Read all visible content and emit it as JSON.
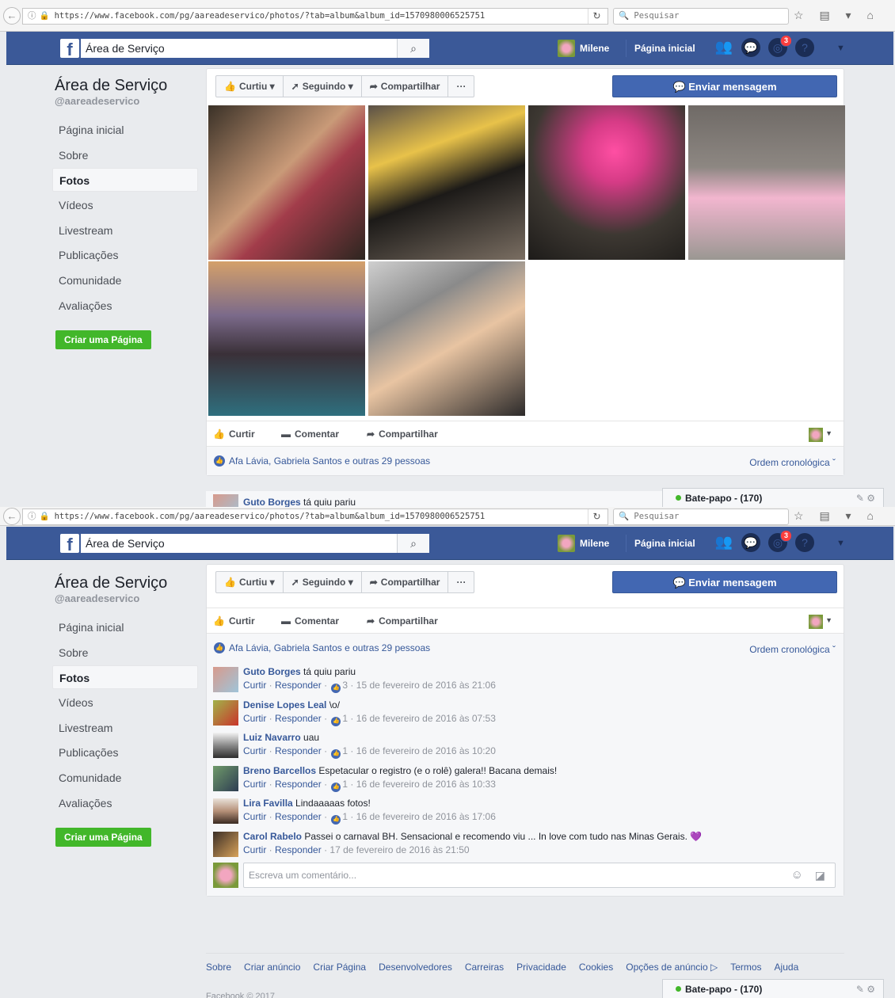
{
  "browser": {
    "url": "https://www.facebook.com/pg/aareadeservico/photos/?tab=album&album_id=1570980006525751",
    "search_placeholder": "Pesquisar"
  },
  "topbar": {
    "search_value": "Área de Serviço",
    "user_name": "Milene",
    "home_label": "Página inicial",
    "notifications_count": "3"
  },
  "page": {
    "name": "Área de Serviço",
    "handle": "@aareadeservico"
  },
  "nav": {
    "items": [
      "Página inicial",
      "Sobre",
      "Fotos",
      "Vídeos",
      "Livestream",
      "Publicações",
      "Comunidade",
      "Avaliações"
    ],
    "active": "Fotos",
    "create_page": "Criar uma Página"
  },
  "actions": {
    "like": "Curtiu",
    "follow": "Seguindo",
    "share": "Compartilhar",
    "more": "···",
    "send_message": "Enviar mensagem"
  },
  "feedback": {
    "like": "Curtir",
    "comment": "Comentar",
    "share": "Compartilhar",
    "likes_text": "Afa Lávia, Gabriela Santos e outras 29 pessoas",
    "order": "Ordem cronológica"
  },
  "comments": [
    {
      "author": "Guto Borges",
      "text": "tá quiu pariu",
      "reactions": "3",
      "time": "15 de fevereiro de 2016 às 21:06"
    },
    {
      "author": "Denise Lopes Leal",
      "text": "\\o/",
      "reactions": "1",
      "time": "16 de fevereiro de 2016 às 07:53"
    },
    {
      "author": "Luiz Navarro",
      "text": "uau",
      "reactions": "1",
      "time": "16 de fevereiro de 2016 às 10:20"
    },
    {
      "author": "Breno Barcellos",
      "text": "Espetacular o registro (e o rolê) galera!! Bacana demais!",
      "reactions": "1",
      "time": "16 de fevereiro de 2016 às 10:33"
    },
    {
      "author": "Lira Favilla",
      "text": "Lindaaaaas fotos!",
      "reactions": "1",
      "time": "16 de fevereiro de 2016 às 17:06"
    },
    {
      "author": "Carol Rabelo",
      "text": "Passei o carnaval BH. Sensacional e recomendo viu ... In love com tudo nas Minas Gerais. 💜",
      "reactions": "",
      "time": "17 de fevereiro de 2016 às 21:50"
    }
  ],
  "comment_actions": {
    "like": "Curtir",
    "reply": "Responder"
  },
  "write_placeholder": "Escreva um comentário...",
  "footer": {
    "links": [
      "Sobre",
      "Criar anúncio",
      "Criar Página",
      "Desenvolvedores",
      "Carreiras",
      "Privacidade",
      "Cookies",
      "Opções de anúncio ▷",
      "Termos",
      "Ajuda"
    ],
    "copyright": "Facebook © 2017"
  },
  "chat": {
    "label": "Bate-papo - (170)"
  },
  "colors": {
    "fb_blue": "#3b5998",
    "button_blue": "#4267b2",
    "green": "#42b72a"
  }
}
